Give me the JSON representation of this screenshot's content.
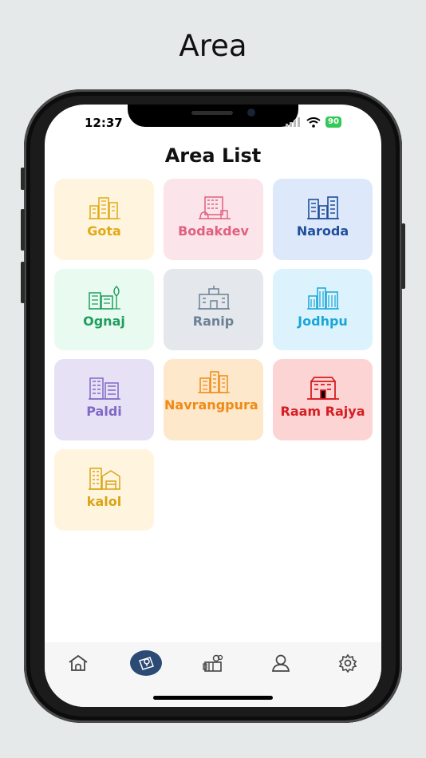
{
  "page_title": "Area",
  "status_bar": {
    "time": "12:37",
    "battery": "90"
  },
  "screen_title": "Area List",
  "colors": {
    "accent": "#2b4a74",
    "tab_icon": "#444444"
  },
  "areas": [
    {
      "label": "Gota",
      "icon": "buildings-icon",
      "bg": "#fff5df",
      "fg": "#e0a915"
    },
    {
      "label": "Bodakdev",
      "icon": "office-icon",
      "bg": "#fbe4ea",
      "fg": "#e0607e"
    },
    {
      "label": "Naroda",
      "icon": "skyline-icon",
      "bg": "#dde9fa",
      "fg": "#1f4f9c"
    },
    {
      "label": "Ognaj",
      "icon": "eco-city-icon",
      "bg": "#e9fbf1",
      "fg": "#1f9d5e"
    },
    {
      "label": "Ranip",
      "icon": "station-icon",
      "bg": "#e4e7eb",
      "fg": "#6b8196"
    },
    {
      "label": "Jodhpu",
      "icon": "towers-icon",
      "bg": "#dcf3fd",
      "fg": "#19a6d8"
    },
    {
      "label": "Paldi",
      "icon": "apartments-icon",
      "bg": "#e6e1f5",
      "fg": "#8068c6"
    },
    {
      "label": "Navrangpura",
      "icon": "highrise-icon",
      "bg": "#fde8cc",
      "fg": "#f08a14"
    },
    {
      "label": "Raam Rajya",
      "icon": "complex-icon",
      "bg": "#fdd4d4",
      "fg": "#d51e23"
    },
    {
      "label": "kalol",
      "icon": "warehouse-icon",
      "bg": "#fff5df",
      "fg": "#d9a415"
    }
  ],
  "tabs": [
    {
      "name": "home",
      "icon": "home-icon"
    },
    {
      "name": "area",
      "icon": "area-map-icon",
      "active": true
    },
    {
      "name": "offers",
      "icon": "offers-icon"
    },
    {
      "name": "profile",
      "icon": "profile-icon"
    },
    {
      "name": "settings",
      "icon": "gear-icon"
    }
  ]
}
